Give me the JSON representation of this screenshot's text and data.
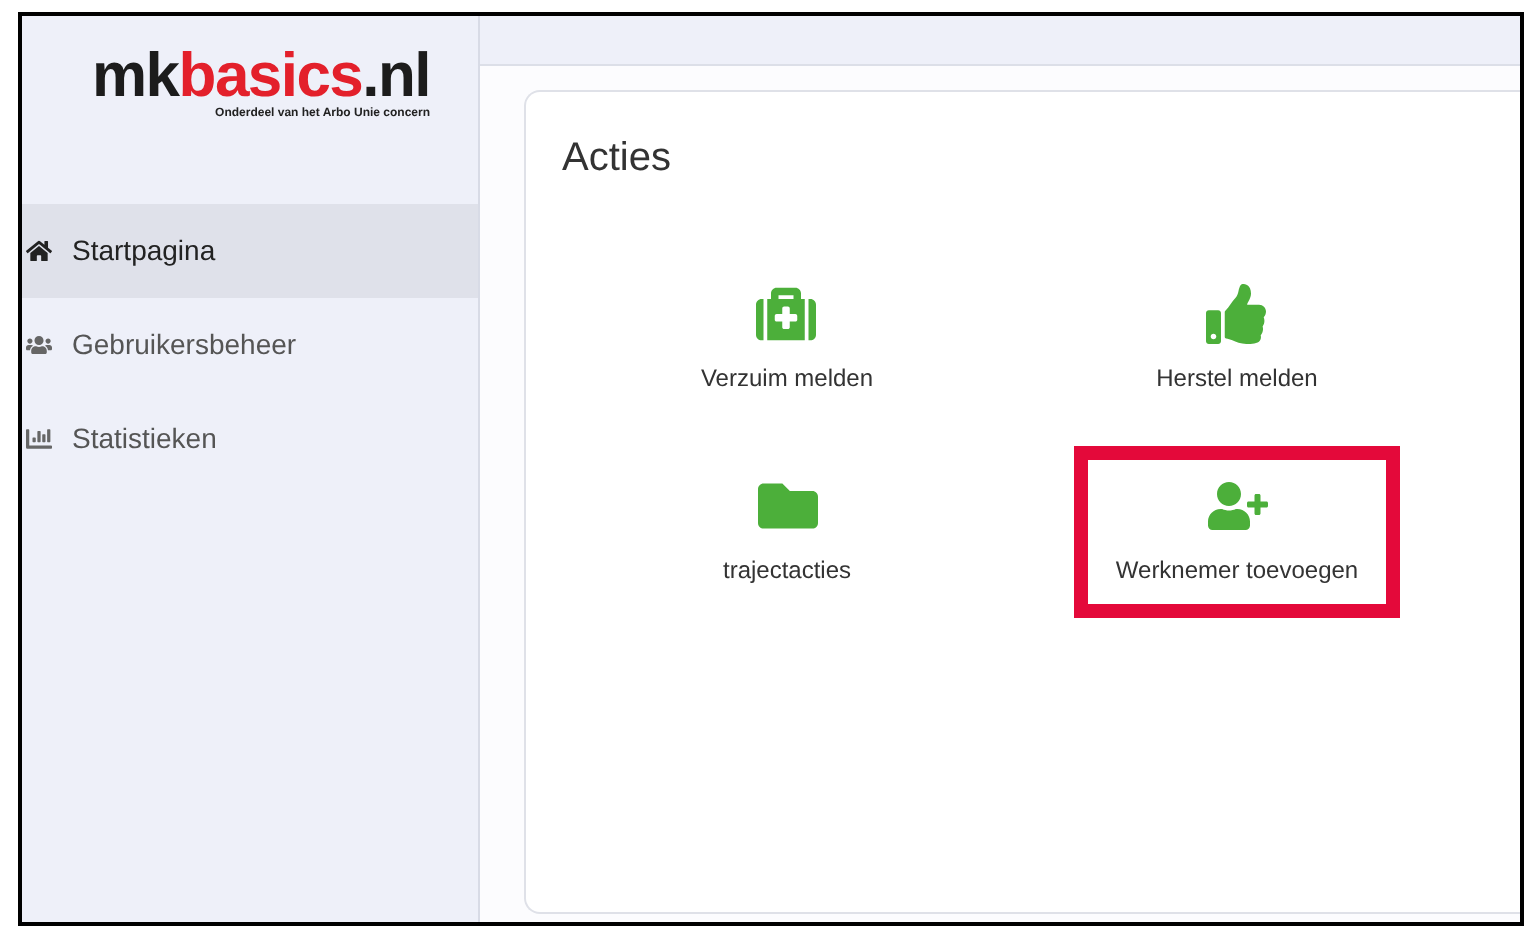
{
  "logo": {
    "parts": [
      {
        "text": "mk",
        "color": "#1c1c1c"
      },
      {
        "text": "basics",
        "color": "#e3202b"
      },
      {
        "text": ".nl",
        "color": "#1c1c1c"
      }
    ],
    "tagline": "Onderdeel van het Arbo Unie concern"
  },
  "sidebar": {
    "items": [
      {
        "label": "Startpagina",
        "kind": "home",
        "selected": true
      },
      {
        "label": "Gebruikersbeheer",
        "kind": "users",
        "selected": false
      },
      {
        "label": "Statistieken",
        "kind": "chart",
        "selected": false
      }
    ]
  },
  "card": {
    "title": "Acties",
    "actions": [
      {
        "label": "Verzuim melden",
        "kind": "medkit",
        "highlighted": false
      },
      {
        "label": "Herstel melden",
        "kind": "thumbs-up",
        "highlighted": false
      },
      {
        "label": "trajectacties",
        "kind": "folder",
        "highlighted": false
      },
      {
        "label": "Werknemer toevoegen",
        "kind": "user-plus",
        "highlighted": true
      }
    ]
  }
}
